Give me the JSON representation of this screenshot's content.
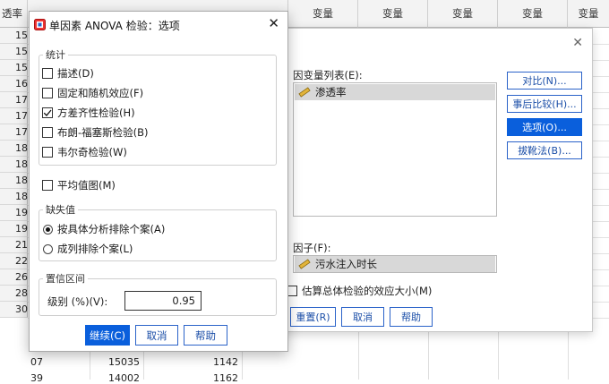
{
  "spreadsheet": {
    "corner_header": "透率",
    "column_headers": [
      "变量",
      "变量",
      "变量",
      "变量",
      "变量"
    ],
    "row_labels": [
      "15",
      "15",
      "15",
      "16",
      "17",
      "17",
      "17",
      "18",
      "18",
      "18",
      "18",
      "19",
      "19",
      "21",
      "22",
      "26",
      "28",
      "30"
    ],
    "row_28": {
      "c1": "07",
      "c2": "15035",
      "c3": "1142"
    },
    "row_30": {
      "c1": "39",
      "c2": "14002",
      "c3": "1162"
    }
  },
  "main_dialog": {
    "dependent_list_label": "因变量列表(E):",
    "dependent_var": "渗透率",
    "factor_label": "因子(F):",
    "factor_var": "污水注入时长",
    "side_buttons": [
      {
        "label": "对比(N)...",
        "active": false
      },
      {
        "label": "事后比较(H)...",
        "active": false
      },
      {
        "label": "选项(O)...",
        "active": true
      },
      {
        "label": "拔靴法(B)...",
        "active": false
      }
    ],
    "effect_size_label": "估算总体检验的效应大小(M)",
    "reset_label": "重置(R)",
    "cancel_label": "取消",
    "help_label": "帮助"
  },
  "options_dialog": {
    "title": "单因素 ANOVA 检验：选项",
    "stats_group_title": "统计",
    "stats_items": [
      {
        "label": "描述(D)",
        "checked": false
      },
      {
        "label": "固定和随机效应(F)",
        "checked": false
      },
      {
        "label": "方差齐性检验(H)",
        "checked": true
      },
      {
        "label": "布朗-福塞斯检验(B)",
        "checked": false
      },
      {
        "label": "韦尔奇检验(W)",
        "checked": false
      }
    ],
    "means_plot_label": "平均值图(M)",
    "missing_group_title": "缺失值",
    "missing_items": [
      {
        "label": "按具体分析排除个案(A)",
        "selected": true
      },
      {
        "label": "成列排除个案(L)",
        "selected": false
      }
    ],
    "ci_group_title": "置信区间",
    "ci_level_label": "级别 (%)(V):",
    "ci_level_value": "0.95",
    "continue_label": "继续(C)",
    "cancel_label": "取消",
    "help_label": "帮助"
  },
  "colors": {
    "accent": "#0a5fdc",
    "selection": "#d8d8d8"
  }
}
